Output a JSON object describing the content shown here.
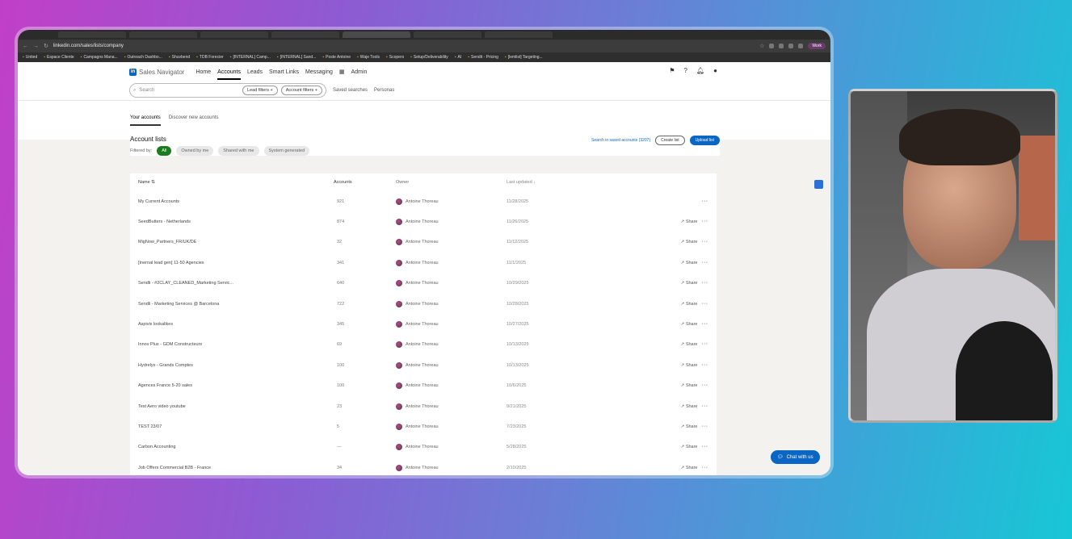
{
  "browser": {
    "url": "linkedin.com/sales/lists/company",
    "profile": "Work",
    "bookmarks": [
      "Untied",
      "Espace Cliente",
      "Campagns Mana...",
      "Outreach Dashbo...",
      "Shuvbend",
      "TDB Forecier",
      "[INTERNAL] Camp...",
      "[INTERNAL] Sand...",
      "Poste Antoine",
      "Waje Tools",
      "Scopers",
      "Setup/Deliverability",
      "AI",
      "Sendit - Pricing",
      "[lemlist] Targeting..."
    ]
  },
  "header": {
    "product": "Sales Navigator",
    "nav": [
      "Home",
      "Accounts",
      "Leads",
      "Smart Links",
      "Messaging",
      "Admin"
    ],
    "search_placeholder": "Search",
    "lead_filters": "Lead filters +",
    "account_filters": "Account filters +",
    "saved_searches": "Saved searches",
    "personas": "Personas"
  },
  "tabs": [
    "Your accounts",
    "Discover new accounts"
  ],
  "lists": {
    "title": "Account lists",
    "filtered_by": "Filtered by:",
    "chips": [
      "All",
      "Owned by me",
      "Shared with me",
      "System generated"
    ],
    "search_saved": "Search in saved accounts (3207)",
    "create_list": "Create list",
    "upload_list": "Upload list"
  },
  "table": {
    "columns": [
      "Name",
      "Accounts",
      "Owner",
      "Last updated"
    ],
    "share_label": "Share",
    "rows": [
      {
        "name": "My Current Accounts",
        "accounts": "921",
        "owner": "Antoine Thoreau",
        "updated": "11/28/2025"
      },
      {
        "name": "SeedButters - Netherlands",
        "accounts": "874",
        "owner": "Antoine Thoreau",
        "updated": "11/26/2025"
      },
      {
        "name": "MigNow_Partners_FR/UK/DE",
        "accounts": "32",
        "owner": "Antoine Thoreau",
        "updated": "11/12/2025"
      },
      {
        "name": "[Inernal lead gen] 11-50 Agencies",
        "accounts": "341",
        "owner": "Antoine Thoreau",
        "updated": "11/1/2025"
      },
      {
        "name": "Sendli - #2CLAY_CLEANED_Marketing Servic...",
        "accounts": "640",
        "owner": "Antoine Thoreau",
        "updated": "10/29/2025"
      },
      {
        "name": "Sendli - Marketing Services @ Barcelona",
        "accounts": "722",
        "owner": "Antoine Thoreau",
        "updated": "10/28/2025"
      },
      {
        "name": "Aspivix lookalikes",
        "accounts": "345",
        "owner": "Antoine Thoreau",
        "updated": "10/27/2025"
      },
      {
        "name": "Innov Plus - GDM Constructeurs",
        "accounts": "69",
        "owner": "Antoine Thoreau",
        "updated": "10/13/2025"
      },
      {
        "name": "Hydrelys - Grands Comptes",
        "accounts": "100",
        "owner": "Antoine Thoreau",
        "updated": "10/13/2025"
      },
      {
        "name": "Agences France 5-20 sales",
        "accounts": "100",
        "owner": "Antoine Thoreau",
        "updated": "10/6/2025"
      },
      {
        "name": "Test Aero video youtube",
        "accounts": "23",
        "owner": "Antoine Thoreau",
        "updated": "9/21/2025"
      },
      {
        "name": "TEST 23/07",
        "accounts": "5",
        "owner": "Antoine Thoreau",
        "updated": "7/23/2025"
      },
      {
        "name": "Carbon Accounting",
        "accounts": "—",
        "owner": "Antoine Thoreau",
        "updated": "5/28/2025"
      },
      {
        "name": "Job Offers Commercial B2B - France",
        "accounts": "34",
        "owner": "Antoine Thoreau",
        "updated": "2/10/2025"
      }
    ]
  },
  "chat": "Chat with us"
}
